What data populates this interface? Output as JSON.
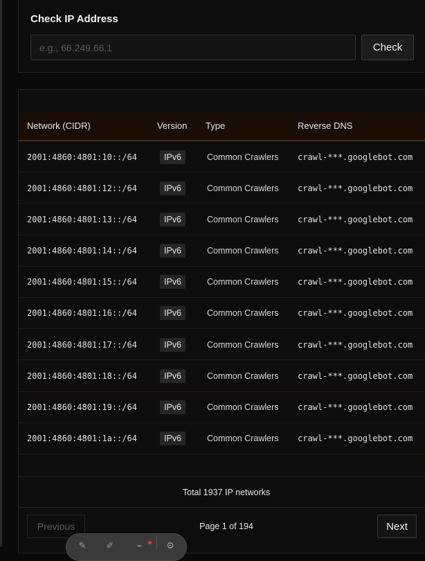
{
  "check": {
    "title": "Check IP Address",
    "input_placeholder": "e.g., 66.249.66.1",
    "input_value": "",
    "button_label": "Check"
  },
  "table": {
    "columns": [
      "Network (CIDR)",
      "Version",
      "Type",
      "Reverse DNS"
    ],
    "rows": [
      {
        "network": "2001:4860:4801:10::/64",
        "version": "IPv6",
        "type": "Common Crawlers",
        "rdns": "crawl-***.googlebot.com"
      },
      {
        "network": "2001:4860:4801:12::/64",
        "version": "IPv6",
        "type": "Common Crawlers",
        "rdns": "crawl-***.googlebot.com"
      },
      {
        "network": "2001:4860:4801:13::/64",
        "version": "IPv6",
        "type": "Common Crawlers",
        "rdns": "crawl-***.googlebot.com"
      },
      {
        "network": "2001:4860:4801:14::/64",
        "version": "IPv6",
        "type": "Common Crawlers",
        "rdns": "crawl-***.googlebot.com"
      },
      {
        "network": "2001:4860:4801:15::/64",
        "version": "IPv6",
        "type": "Common Crawlers",
        "rdns": "crawl-***.googlebot.com"
      },
      {
        "network": "2001:4860:4801:16::/64",
        "version": "IPv6",
        "type": "Common Crawlers",
        "rdns": "crawl-***.googlebot.com"
      },
      {
        "network": "2001:4860:4801:17::/64",
        "version": "IPv6",
        "type": "Common Crawlers",
        "rdns": "crawl-***.googlebot.com"
      },
      {
        "network": "2001:4860:4801:18::/64",
        "version": "IPv6",
        "type": "Common Crawlers",
        "rdns": "crawl-***.googlebot.com"
      },
      {
        "network": "2001:4860:4801:19::/64",
        "version": "IPv6",
        "type": "Common Crawlers",
        "rdns": "crawl-***.googlebot.com"
      },
      {
        "network": "2001:4860:4801:1a::/64",
        "version": "IPv6",
        "type": "Common Crawlers",
        "rdns": "crawl-***.googlebot.com"
      }
    ],
    "total_text": "Total 1937 IP networks"
  },
  "pagination": {
    "previous_label": "Previous",
    "page_text": "Page 1 of 194",
    "next_label": "Next"
  },
  "toolbar": {
    "icons": [
      "pen-icon",
      "brush-icon",
      "tag-icon",
      "gear-icon"
    ]
  },
  "colors": {
    "header_bg": "#1a0d06",
    "accent_border": "#4a2a17",
    "page_bg": "#0a0a0a"
  }
}
